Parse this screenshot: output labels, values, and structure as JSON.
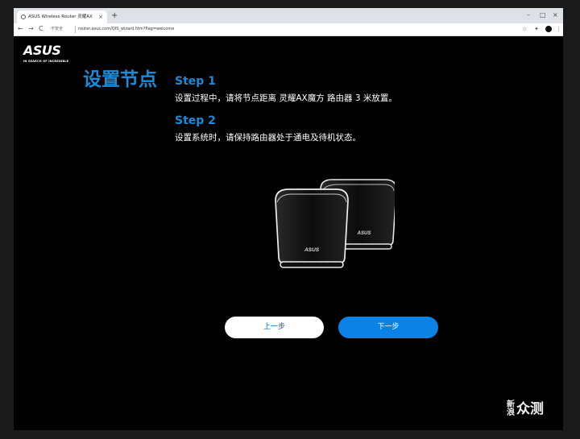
{
  "browser": {
    "tab_title": "ASUS Wireless Router 灵耀AX",
    "tab_close": "×",
    "new_tab": "+",
    "window_controls": [
      "–",
      "□",
      "×"
    ],
    "nav": [
      "←",
      "→",
      "C"
    ],
    "security_label": "不安全",
    "url": "router.asus.com/QIS_wizard.htm?flag=welcome"
  },
  "page": {
    "logo": "ASUS",
    "tagline": "IN SEARCH OF INCREDIBLE",
    "title": "设置节点",
    "step1_label": "Step 1",
    "step1_text": "设置过程中，请将节点距离 灵耀AX魔方 路由器 3 米放置。",
    "step2_label": "Step 2",
    "step2_text": "设置系统时，请保持路由器处于通电及待机状态。",
    "device_brand": "ASUS",
    "prev_button": "上一步",
    "next_button": "下一步"
  },
  "watermark": {
    "small": "新浪",
    "big": "众测"
  },
  "colors": {
    "accent": "#1a8bd8",
    "button_blue": "#0a82e6"
  }
}
